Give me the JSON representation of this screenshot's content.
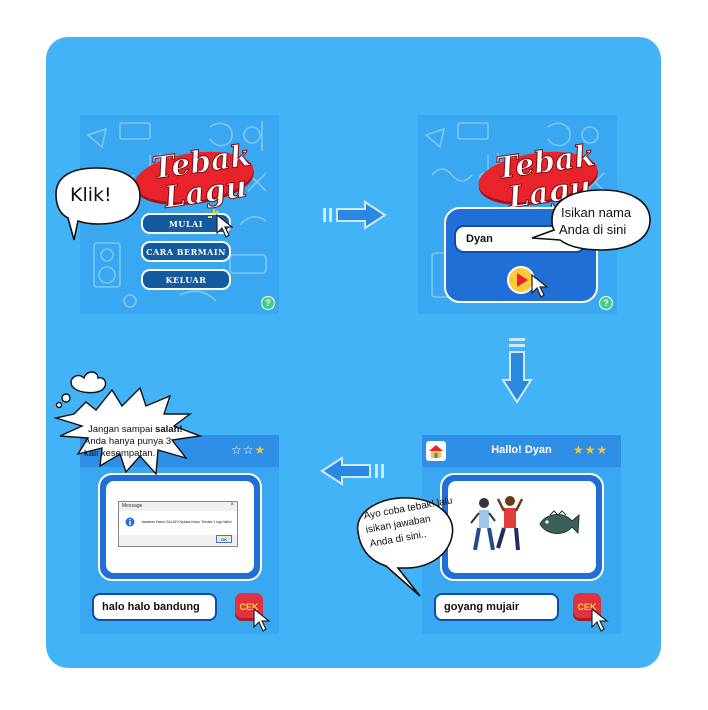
{
  "panel1": {
    "logo": {
      "line1": "Tebak",
      "line2": "Lagu"
    },
    "menu": [
      {
        "label": "MULAI"
      },
      {
        "label": "CARA BERMAIN"
      },
      {
        "label": "KELUAR"
      }
    ],
    "help": "?",
    "bubble": "Klik!"
  },
  "panel2": {
    "logo": {
      "line1": "Tebak",
      "line2": "Lagu"
    },
    "name_value": "Dyan",
    "help": "?",
    "bubble": [
      "Isikan nama",
      "Anda di sini"
    ]
  },
  "panel3": {
    "title": "Hallo! Dyan",
    "stars": "★★★",
    "answer": "goyang mujair",
    "cek": "CEK",
    "bubble": [
      "Ayo coba tebak! lalu",
      "isikan jawaban",
      "Anda di sini.."
    ]
  },
  "panel4": {
    "stars_empty": "☆☆",
    "stars_full": "★",
    "answer": "halo halo bandung",
    "cek": "CEK",
    "dialog": {
      "title": "Message",
      "close": "×",
      "message": "Jawaban Kamu SALAH! Nyawa Kamu Tersisa 1 lagi haiiio!",
      "ok": "OK"
    },
    "bubble": {
      "line1_pre": "Jangan sampai ",
      "line1_bold": "salah!",
      "line2": "Anda hanya punya 3",
      "line3": "kali kesempatan."
    }
  },
  "colors": {
    "card": "#43b3f7",
    "panel": "#3aa8f0",
    "button": "#145a9e",
    "logo_red": "#e8232c",
    "arrow": "#2a88e0",
    "star": "#f6c53a"
  }
}
